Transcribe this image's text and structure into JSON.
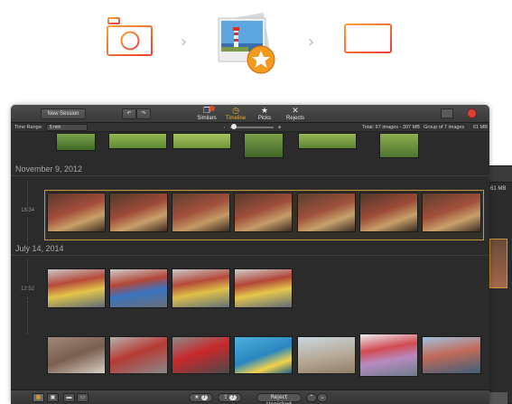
{
  "toolbar": {
    "new_session": "New Session",
    "undo": "↶",
    "redo": "↷",
    "tabs": [
      {
        "label": "Similars",
        "icon": "similars-icon"
      },
      {
        "label": "Timeline",
        "icon": "clock-icon"
      },
      {
        "label": "Picks",
        "icon": "star-icon"
      },
      {
        "label": "Rejects",
        "icon": "x-icon"
      }
    ]
  },
  "subbar": {
    "time_range_label": "Time Range:",
    "time_range_value": "5 min",
    "total": "Total: 67 images - 307 MB",
    "group": "Group of 7 images",
    "group_size": "61 MB",
    "back_size": "61 MB"
  },
  "sections": [
    {
      "date": "November 9, 2012",
      "time": "18:34"
    },
    {
      "date": "July 14, 2014",
      "time": "12:52"
    }
  ],
  "bottombar": {
    "picks_count": "7",
    "share_count": "7",
    "reject_unpicked": "Reject Unpicked",
    "prev": "⌃",
    "next": "⌄"
  },
  "colors": {
    "accent": "#f4a92a",
    "flow_gradient_start": "#f7a23a",
    "flow_gradient_end": "#e8413c",
    "selection_border": "#c8963c"
  }
}
